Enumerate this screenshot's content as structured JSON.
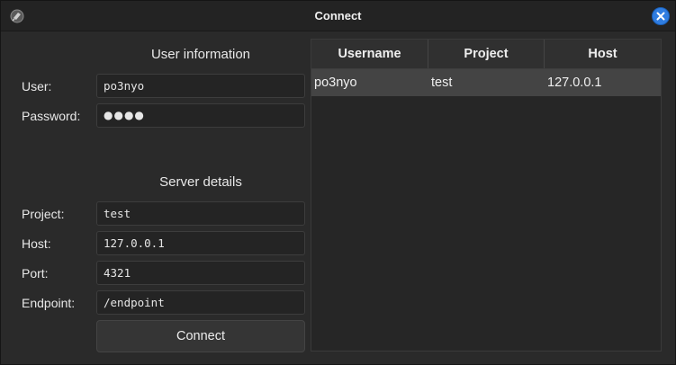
{
  "window": {
    "title": "Connect"
  },
  "user_section": {
    "heading": "User information",
    "user_label": "User:",
    "user_value": "po3nyo",
    "password_label": "Password:",
    "password_value": "●●●●"
  },
  "server_section": {
    "heading": "Server details",
    "project_label": "Project:",
    "project_value": "test",
    "host_label": "Host:",
    "host_value": "127.0.0.1",
    "port_label": "Port:",
    "port_value": "4321",
    "endpoint_label": "Endpoint:",
    "endpoint_value": "/endpoint"
  },
  "connect_label": "Connect",
  "table": {
    "columns": [
      "Username",
      "Project",
      "Host"
    ],
    "rows": [
      {
        "username": "po3nyo",
        "project": "test",
        "host": "127.0.0.1"
      }
    ]
  },
  "colors": {
    "close_button": "#2f7de1",
    "selected_row": "#444444"
  }
}
